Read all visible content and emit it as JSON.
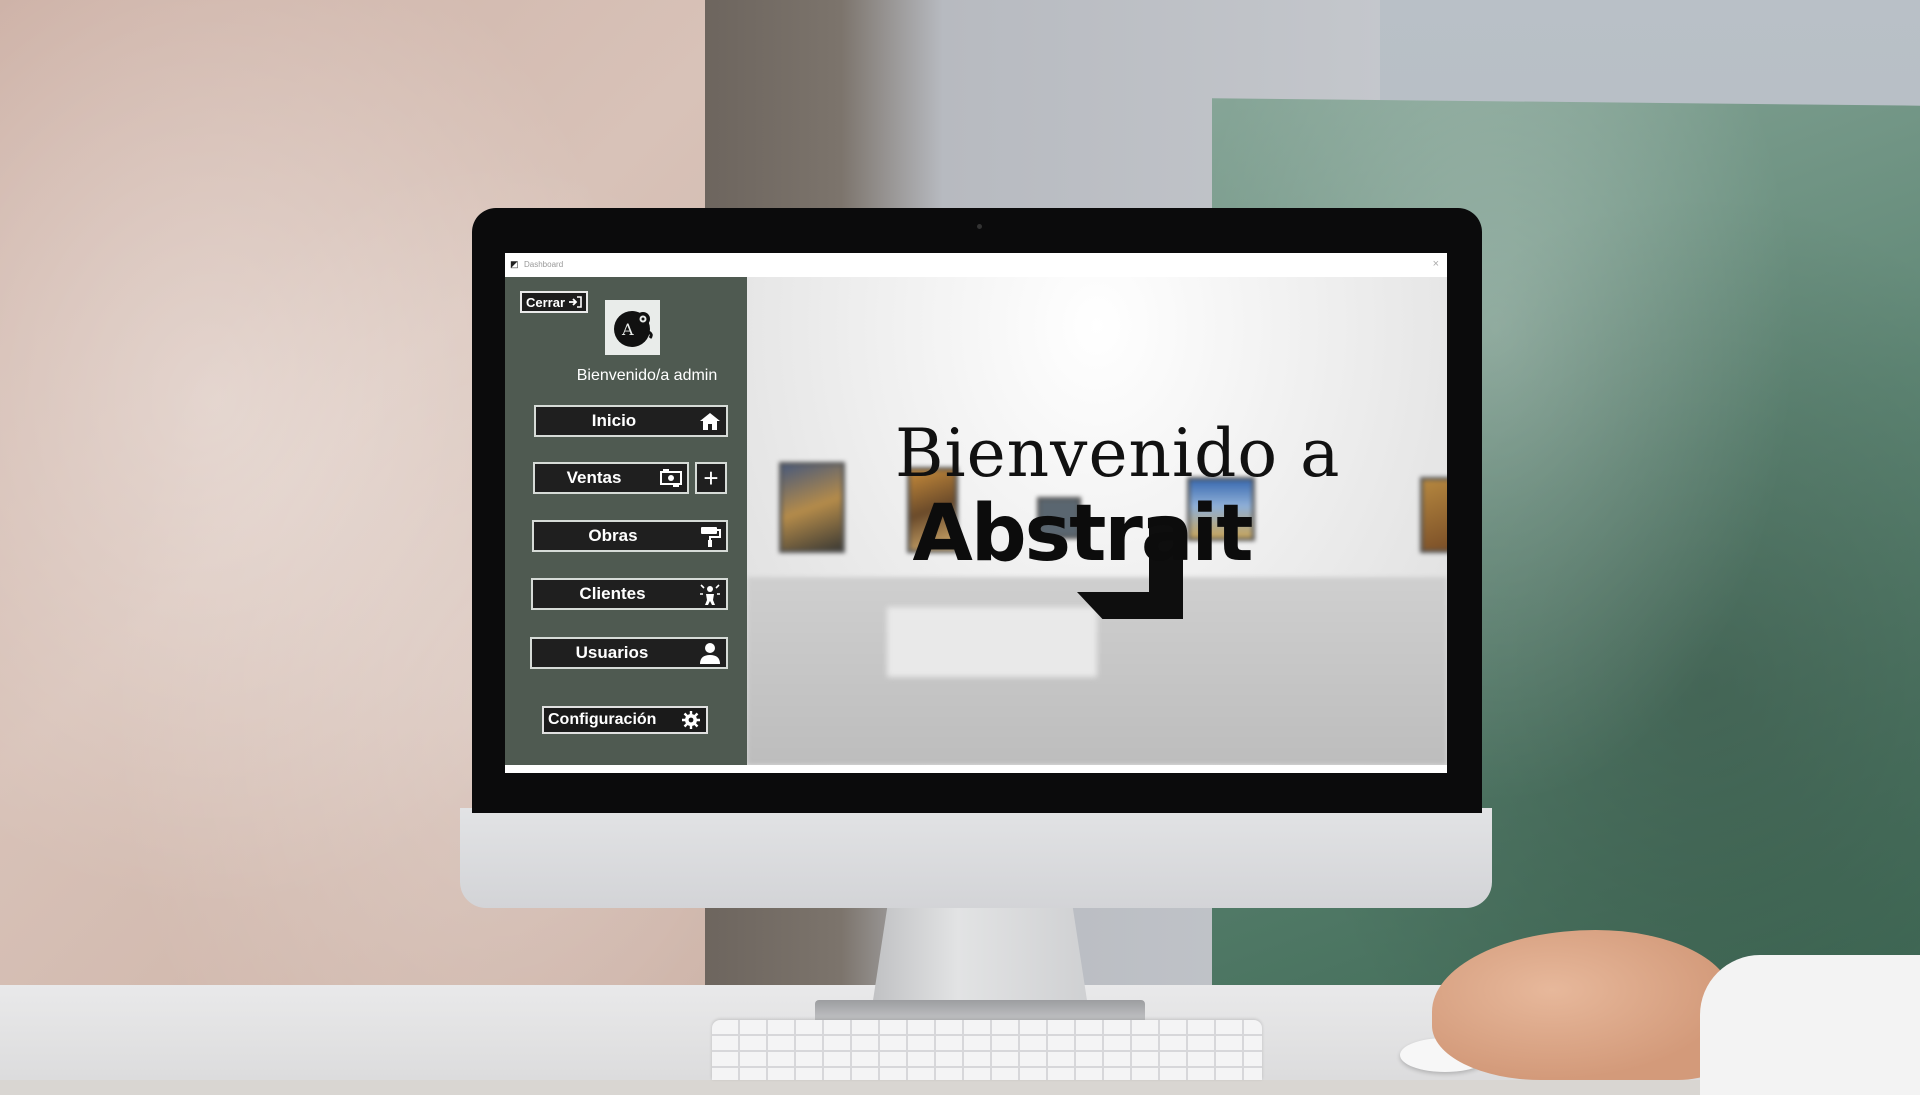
{
  "window": {
    "title": "Dashboard",
    "close_glyph": "×"
  },
  "sidebar": {
    "logout_label": "Cerrar",
    "logout_icon": "logout-arrow-icon",
    "welcome_text": "Bienvenido/a admin",
    "nav": {
      "inicio": {
        "label": "Inicio",
        "icon": "home-icon"
      },
      "ventas": {
        "label": "Ventas",
        "icon": "money-exchange-icon",
        "add_glyph": "+"
      },
      "obras": {
        "label": "Obras",
        "icon": "paint-roller-icon"
      },
      "clientes": {
        "label": "Clientes",
        "icon": "person-star-icon"
      },
      "usuarios": {
        "label": "Usuarios",
        "icon": "user-icon"
      }
    },
    "config_label": "Configuración",
    "config_icon": "gear-icon",
    "background_color": "#4f5a51"
  },
  "hero": {
    "line1": "Bienvenido a",
    "line2": "Abstrait"
  }
}
